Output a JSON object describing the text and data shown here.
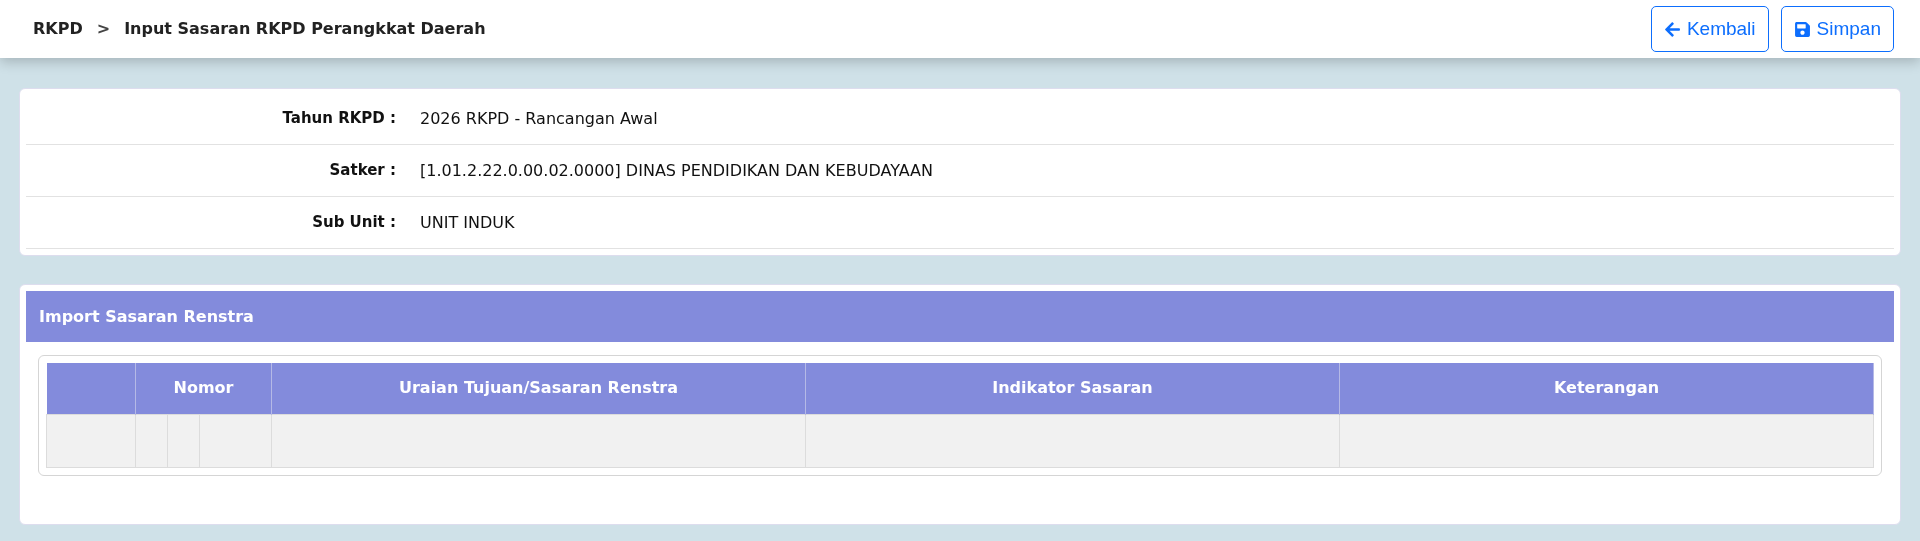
{
  "breadcrumb": {
    "root": "RKPD",
    "separator": ">",
    "current": "Input Sasaran RKPD Perangkkat Daerah"
  },
  "buttons": [
    {
      "kind": "back",
      "label": "Kembali"
    },
    {
      "kind": "save",
      "label": "Simpan"
    }
  ],
  "info": [
    {
      "label": "Tahun RKPD :",
      "value": "2026 RKPD - Rancangan Awal"
    },
    {
      "label": "Satker :",
      "value": "[1.01.2.22.0.00.02.0000] DINAS PENDIDIKAN DAN KEBUDAYAAN"
    },
    {
      "label": "Sub Unit :",
      "value": "UNIT INDUK"
    }
  ],
  "section": {
    "title": "Import Sasaran Renstra",
    "table": {
      "columns": [
        "Nomor",
        "Uraian Tujuan/Sasaran Renstra",
        "Indikator Sasaran",
        "Keterangan"
      ]
    }
  }
}
